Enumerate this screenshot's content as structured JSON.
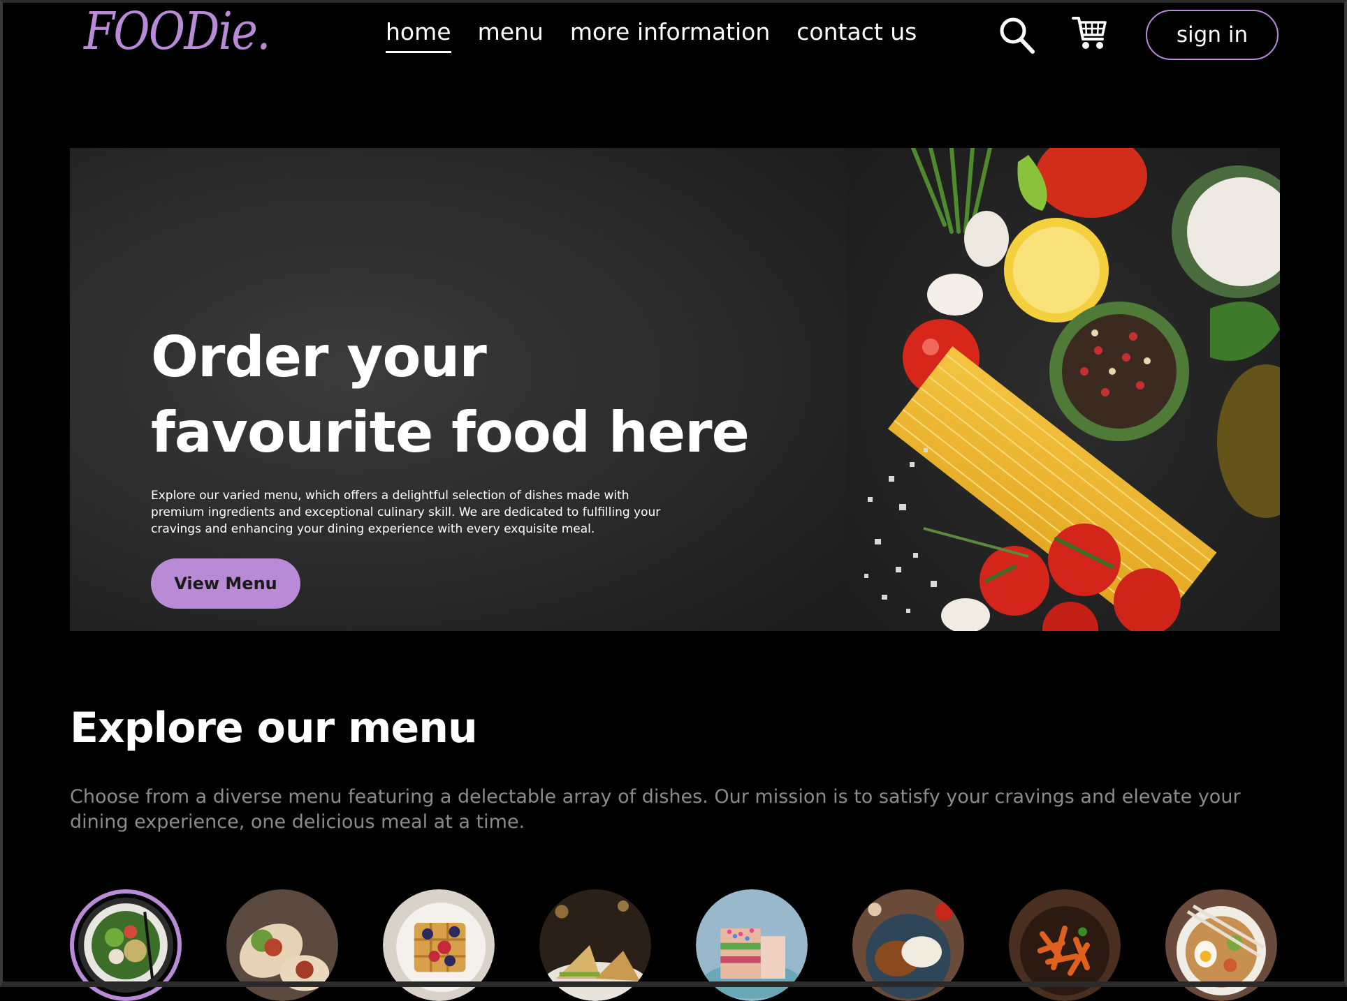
{
  "header": {
    "logo_text": "FOODie.",
    "nav": [
      {
        "label": "home",
        "active": true
      },
      {
        "label": "menu",
        "active": false
      },
      {
        "label": "more information",
        "active": false
      },
      {
        "label": "contact us",
        "active": false
      }
    ],
    "icons": [
      "search-icon",
      "cart-icon"
    ],
    "signin_label": "sign in"
  },
  "hero": {
    "title_line1": "Order your",
    "title_line2": "favourite food here",
    "description": "Explore our varied menu, which offers a delightful selection of dishes made with premium ingredients and exceptional culinary skill. We are dedicated to fulfilling your cravings and enhancing your dining experience with every exquisite meal.",
    "button_label": "View Menu"
  },
  "explore": {
    "title": "Explore our menu",
    "description": "Choose from a diverse menu featuring a delectable array of dishes. Our mission is to satisfy your cravings and elevate your dining experience, one delicious meal at a time.",
    "items": [
      {
        "icon": "salad-bowl",
        "selected": true
      },
      {
        "icon": "wrap-rolls",
        "selected": false
      },
      {
        "icon": "waffle-dessert",
        "selected": false
      },
      {
        "icon": "sandwich",
        "selected": false
      },
      {
        "icon": "cake",
        "selected": false
      },
      {
        "icon": "rice-curry",
        "selected": false
      },
      {
        "icon": "pasta-bowl",
        "selected": false
      },
      {
        "icon": "noodle-bowl",
        "selected": false
      }
    ]
  },
  "colors": {
    "accent": "#b98ad6",
    "background": "#000000",
    "muted_text": "#8b8b8b"
  }
}
